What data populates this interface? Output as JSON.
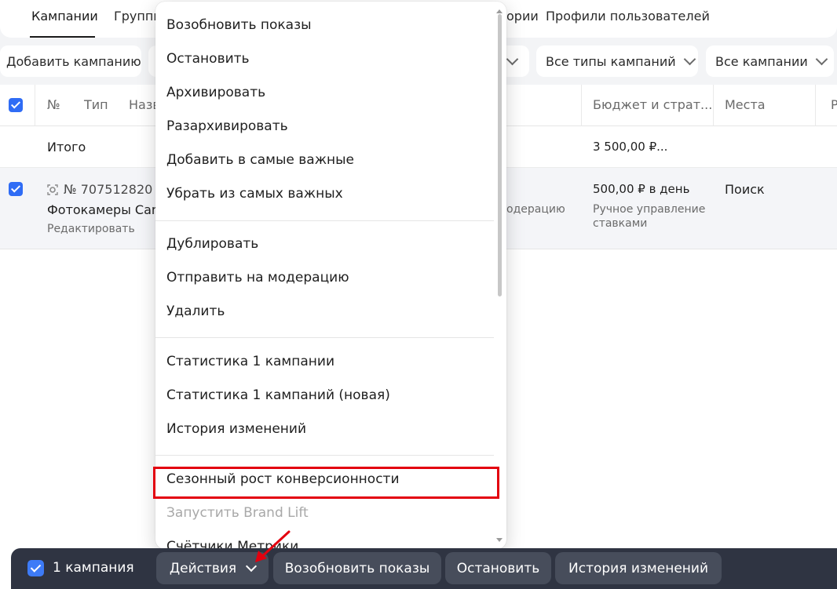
{
  "tabs": {
    "campaigns": "Кампании",
    "groups": "Группы",
    "categories_fragment": "ории",
    "user_profiles": "Профили пользователей"
  },
  "toolbar": {
    "add_campaign": "Добавить кампанию",
    "all_campaign_types": "Все типы кампаний",
    "all_campaigns": "Все кампании"
  },
  "table": {
    "headers": {
      "number": "№",
      "type": "Тип",
      "name_fragment": "Назв",
      "budget": "Бюджет и страт...",
      "places": "Места",
      "next_fragment": "Р"
    },
    "total_row": {
      "label": "Итого",
      "budget": "3 500,00 ₽..."
    },
    "campaign_row": {
      "number": "№ 707512820",
      "name": "Фотокамеры Canc",
      "edit_link": "Редактировать",
      "status_fragment": "одерацию",
      "budget": "500,00 ₽ в день",
      "strategy_line1": "Ручное управление",
      "strategy_line2": "ставками",
      "places": "Поиск"
    }
  },
  "menu": {
    "items": [
      "Возобновить показы",
      "Остановить",
      "Архивировать",
      "Разархивировать",
      "Добавить в самые важные",
      "Убрать из самых важных",
      "Дублировать",
      "Отправить на модерацию",
      "Удалить",
      "Статистика 1 кампании",
      "Статистика 1 кампаний (новая)",
      "История изменений",
      "Сезонный рост конверсионности",
      "Запустить Brand Lift",
      "Счётчики Метрики"
    ]
  },
  "bottom_bar": {
    "selected_count": "1 кампания",
    "actions": "Действия",
    "resume": "Возобновить показы",
    "stop": "Остановить",
    "history": "История изменений"
  },
  "colors": {
    "accent_blue": "#2f6cf5",
    "highlight_red": "#e3000f",
    "arrow_red": "#e3000f",
    "bottom_bar": "#2f3442"
  }
}
